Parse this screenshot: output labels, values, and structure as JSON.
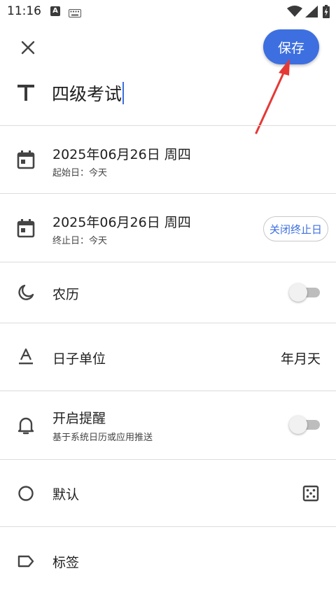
{
  "status_bar": {
    "time": "11:16",
    "notification_letter": "A",
    "icons": [
      "keyboard-icon",
      "wifi-icon",
      "signal-icon",
      "battery-icon"
    ]
  },
  "header": {
    "save_label": "保存",
    "title_value": "四级考试",
    "accent_color": "#3d6fe0",
    "annotation_arrow_color": "#e53935"
  },
  "rows": {
    "start_date": {
      "title": "2025年06月26日 周四",
      "subtitle": "起始日：今天",
      "icon": "calendar-icon"
    },
    "end_date": {
      "title": "2025年06月26日 周四",
      "subtitle": "终止日：今天",
      "icon": "calendar-icon",
      "chip_label": "关闭终止日"
    },
    "lunar": {
      "title": "农历",
      "icon": "moon-icon",
      "toggle_on": false
    },
    "unit": {
      "title": "日子单位",
      "value": "年月天",
      "icon": "text-format-icon"
    },
    "reminder": {
      "title": "开启提醒",
      "subtitle": "基于系统日历或应用推送",
      "icon": "bell-icon",
      "toggle_on": false
    },
    "default": {
      "title": "默认",
      "icon": "circle-icon",
      "action_icon": "dice-icon"
    },
    "tag": {
      "title": "标签",
      "icon": "label-icon"
    }
  }
}
